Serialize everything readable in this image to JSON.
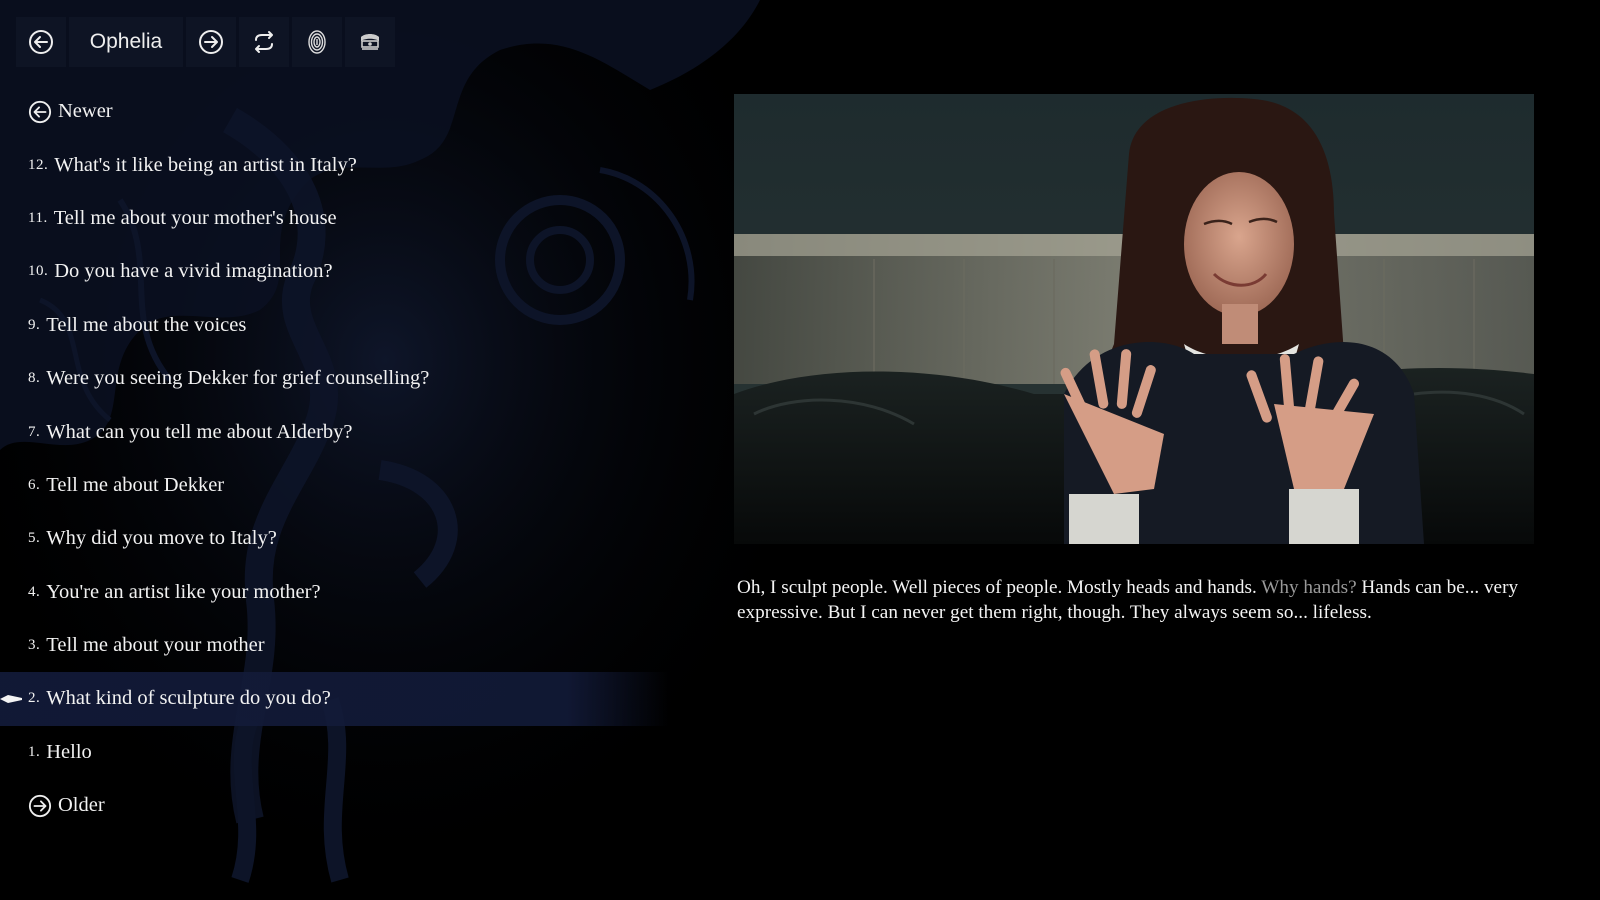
{
  "toolbar": {
    "character_name": "Ophelia",
    "buttons": [
      {
        "icon": "arrow-left-circle-icon"
      },
      {
        "icon": "arrow-right-circle-icon"
      },
      {
        "icon": "repeat-icon"
      },
      {
        "icon": "fingerprint-icon"
      },
      {
        "icon": "badge-icon"
      }
    ]
  },
  "nav": {
    "newer_label": "Newer",
    "older_label": "Older"
  },
  "questions": [
    {
      "num": "12.",
      "text": "What's it like being an artist in Italy?"
    },
    {
      "num": "11.",
      "text": "Tell me about your mother's house"
    },
    {
      "num": "10.",
      "text": "Do you have a vivid imagination?"
    },
    {
      "num": "9.",
      "text": "Tell me about the voices"
    },
    {
      "num": "8.",
      "text": "Were you seeing Dekker for grief counselling?"
    },
    {
      "num": "7.",
      "text": "What can you tell me about Alderby?"
    },
    {
      "num": "6.",
      "text": "Tell me about Dekker"
    },
    {
      "num": "5.",
      "text": "Why did you move to Italy?"
    },
    {
      "num": "4.",
      "text": "You're an artist like your mother?"
    },
    {
      "num": "3.",
      "text": "Tell me about your mother"
    },
    {
      "num": "2.",
      "text": "What kind of sculpture do you do?",
      "selected": true
    },
    {
      "num": "1.",
      "text": "Hello"
    }
  ],
  "subtitle": {
    "line_a": "Oh, I sculpt people.  Well  pieces of people.  Mostly heads and hands.",
    "reply": "Why hands?",
    "line_b": "Hands can be...  very expressive.  But I can never get them right, though.  They always seem so...  lifeless."
  },
  "colors": {
    "background": "#000000",
    "toolbar_button": "#0e1424",
    "selected_row": "#121a38",
    "ornament": "#0b1122",
    "reply_text": "#9a9a9a"
  }
}
